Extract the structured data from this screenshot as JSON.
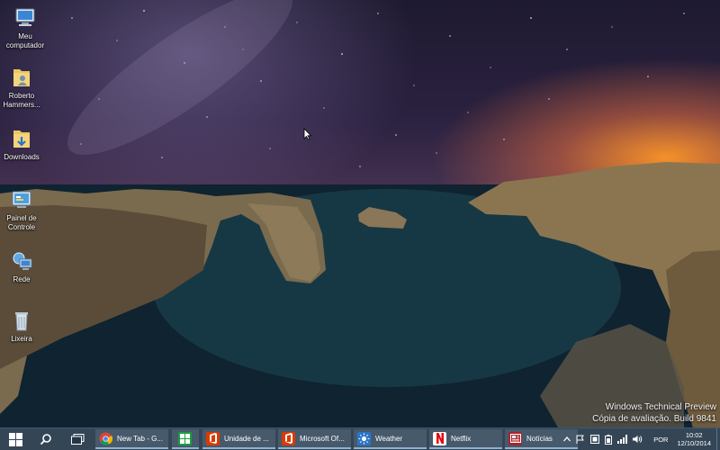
{
  "desktop": {
    "icons": [
      {
        "label": "Meu computador",
        "icon": "computer-icon"
      },
      {
        "label": "Roberto Hammers...",
        "icon": "user-folder-icon"
      },
      {
        "label": "Downloads",
        "icon": "downloads-folder-icon"
      },
      {
        "label": "Painel de Controle",
        "icon": "control-panel-icon"
      },
      {
        "label": "Rede",
        "icon": "network-icon"
      },
      {
        "label": "Lixeira",
        "icon": "recycle-bin-icon"
      }
    ],
    "watermark": {
      "line1": "Windows Technical Preview",
      "line2": "Cópia de avaliação. Build 9841"
    }
  },
  "taskbar": {
    "start_icon": "windows-logo-icon",
    "search_icon": "search-icon",
    "task_view_icon": "task-view-icon",
    "tasks": [
      {
        "label": "New Tab - G...",
        "icon": "chrome-icon"
      },
      {
        "label": "",
        "icon": "store-icon"
      },
      {
        "label": "Unidade de ...",
        "icon": "office-icon"
      },
      {
        "label": "Microsoft Of...",
        "icon": "office-icon"
      },
      {
        "label": "Weather",
        "icon": "weather-icon"
      },
      {
        "label": "Netflix",
        "icon": "netflix-icon"
      },
      {
        "label": "Notícias",
        "icon": "news-icon"
      }
    ],
    "tray": {
      "language": "POR",
      "time": "10:02",
      "date": "12/10/2014"
    }
  },
  "colors": {
    "taskbar_bg": "#233648",
    "accent": "#8fb2d0",
    "office": "#d83b01",
    "store": "#1d9d3e",
    "weather": "#2b74c7",
    "netflix": "#e50914",
    "news": "#a4262c"
  }
}
